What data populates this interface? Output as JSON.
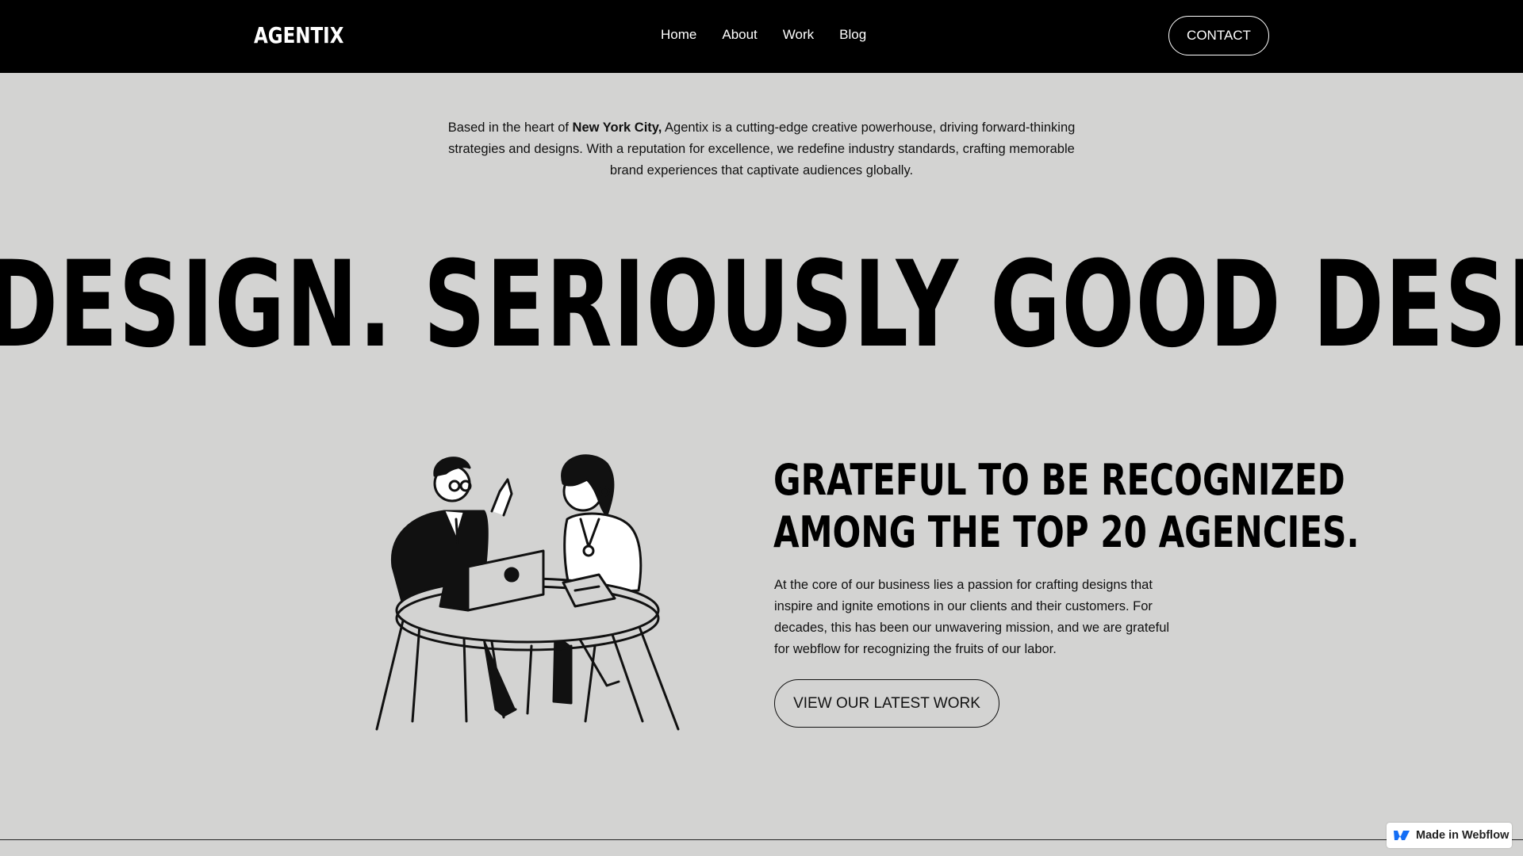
{
  "nav": {
    "logo": "AGENTIX",
    "links": [
      "Home",
      "About",
      "Work",
      "Blog"
    ],
    "contact_label": "CONTACT"
  },
  "intro": {
    "prefix": "Based in the heart of ",
    "highlight": "New York City,",
    "rest": " Agentix is a cutting-edge creative powerhouse, driving forward-thinking strategies and designs. With a reputation for excellence, we redefine industry standards, crafting memorable brand experiences that captivate audiences globally."
  },
  "marquee": {
    "text": "OD DESIGN. SERIOUSLY GOOD DESIGN. SERIOUSLY GOOD DESIGN."
  },
  "award": {
    "heading_line1": "GRATEFUL TO BE RECOGNIZED",
    "heading_line2": "AMONG THE TOP 20 AGENCIES.",
    "text": "At the core of our business lies a passion for crafting designs that inspire and ignite emotions in our clients and their customers. For decades, this has been our unwavering mission, and we are grateful for webflow for recognizing the fruits of our labor.",
    "button_label": "VIEW OUR LATEST WORK"
  },
  "badge": {
    "label": "Made in Webflow",
    "icon": "webflow-icon",
    "brand_color": "#146ef5"
  }
}
